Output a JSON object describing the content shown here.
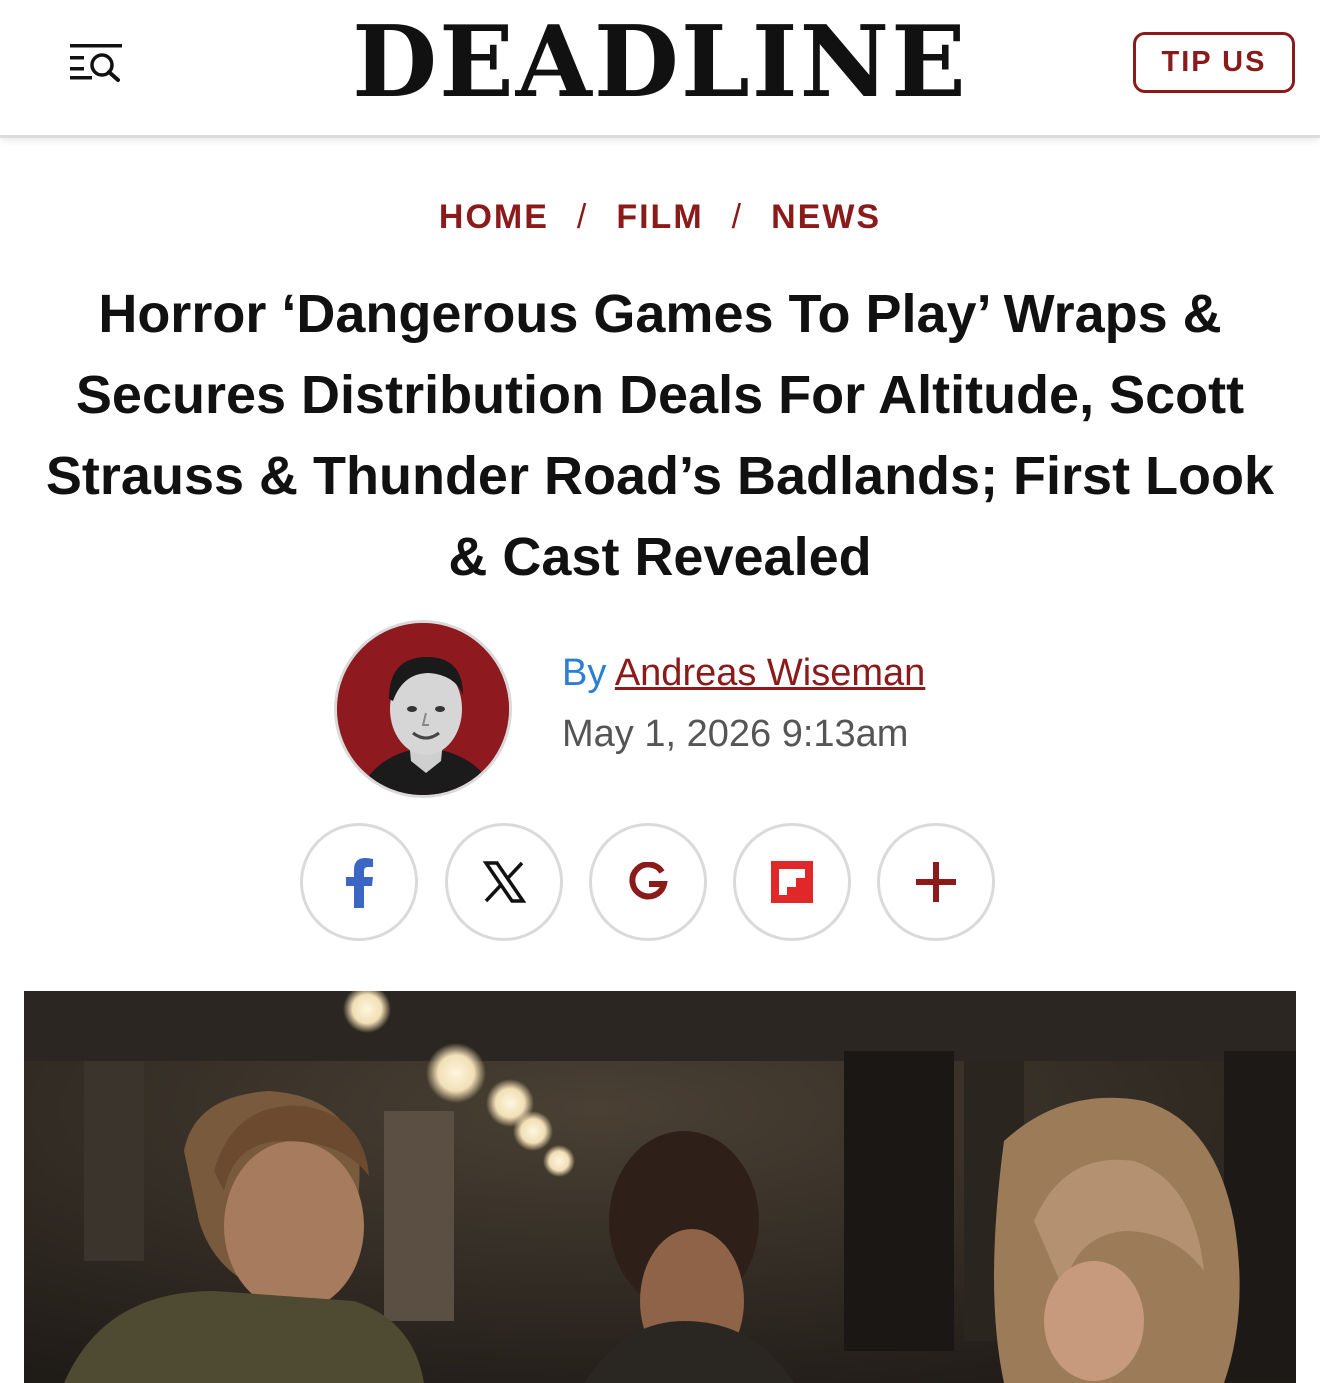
{
  "header": {
    "logo": "DEADLINE",
    "tip_button": "TIP US",
    "menu_icon": "menu-search-icon"
  },
  "breadcrumb": {
    "items": [
      "HOME",
      "FILM",
      "NEWS"
    ],
    "separator": "/"
  },
  "article": {
    "headline": "Horror ‘Dangerous Games To Play’ Wraps & Secures Distribution Deals For Altitude, Scott Strauss & Thunder Road’s Badlands; First Look & Cast Revealed",
    "byline_prefix": "By",
    "author": "Andreas Wiseman",
    "date": "May 1, 2026 9:13am"
  },
  "share": {
    "icons": [
      "facebook-icon",
      "x-icon",
      "google-icon",
      "flipboard-icon",
      "plus-icon"
    ]
  },
  "colors": {
    "brand_red": "#8b1a1a",
    "byline_blue": "#2a7fd4",
    "facebook_blue": "#3b66c4",
    "flipboard_red": "#e12828"
  }
}
